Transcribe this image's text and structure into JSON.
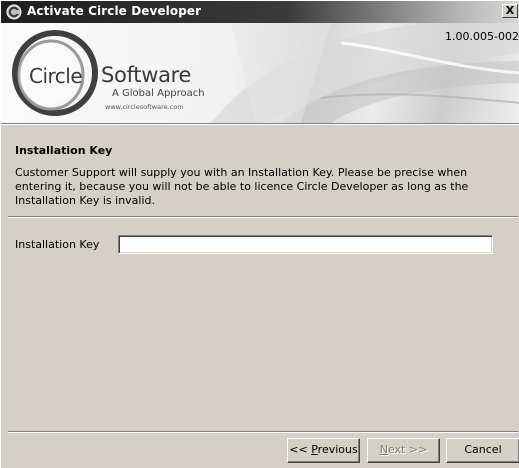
{
  "window": {
    "title": "Activate Circle Developer",
    "close_label": "X"
  },
  "banner": {
    "logo_circle_text": "Circle",
    "logo_software_text": "Software",
    "tagline": "A Global Approach",
    "url": "www.circlesoftware.com",
    "version": "1.00.005-002"
  },
  "content": {
    "heading": "Installation Key",
    "description": "Customer Support will supply you with an Installation Key. Please be precise when entering it, because you will not be able to licence Circle Developer as long as the Installation Key is invalid.",
    "field_label": "Installation Key",
    "field_value": ""
  },
  "buttons": {
    "previous_prefix": "<< ",
    "previous_mnemonic": "P",
    "previous_rest": "revious",
    "next_mnemonic": "N",
    "next_rest": "ext >>",
    "cancel": "Cancel",
    "next_enabled": false
  },
  "colors": {
    "titlebar_dark": "#1e1e1e",
    "dialog_face": "#d4d0c8",
    "disabled_text": "#808080"
  }
}
